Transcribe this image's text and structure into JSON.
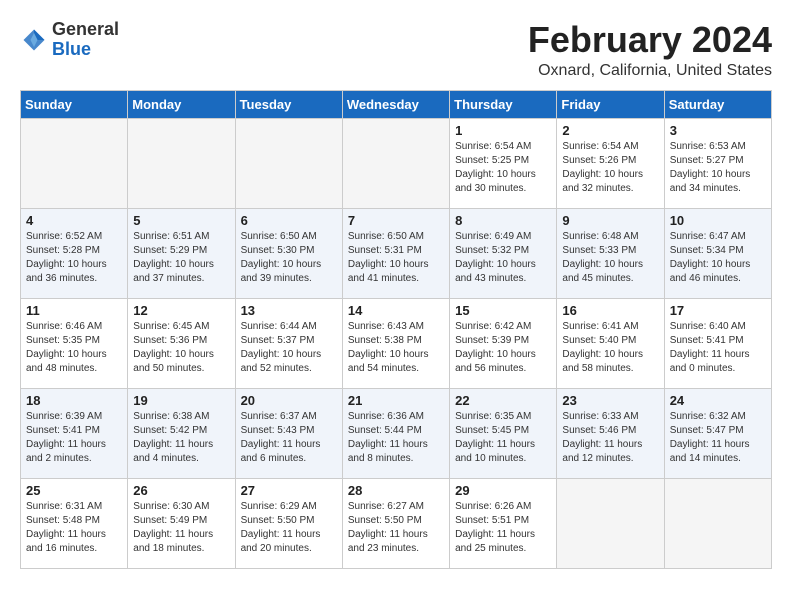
{
  "header": {
    "logo_general": "General",
    "logo_blue": "Blue",
    "month_title": "February 2024",
    "location": "Oxnard, California, United States"
  },
  "days_of_week": [
    "Sunday",
    "Monday",
    "Tuesday",
    "Wednesday",
    "Thursday",
    "Friday",
    "Saturday"
  ],
  "weeks": [
    {
      "alt": false,
      "days": [
        {
          "num": "",
          "info": ""
        },
        {
          "num": "",
          "info": ""
        },
        {
          "num": "",
          "info": ""
        },
        {
          "num": "",
          "info": ""
        },
        {
          "num": "1",
          "info": "Sunrise: 6:54 AM\nSunset: 5:25 PM\nDaylight: 10 hours\nand 30 minutes."
        },
        {
          "num": "2",
          "info": "Sunrise: 6:54 AM\nSunset: 5:26 PM\nDaylight: 10 hours\nand 32 minutes."
        },
        {
          "num": "3",
          "info": "Sunrise: 6:53 AM\nSunset: 5:27 PM\nDaylight: 10 hours\nand 34 minutes."
        }
      ]
    },
    {
      "alt": true,
      "days": [
        {
          "num": "4",
          "info": "Sunrise: 6:52 AM\nSunset: 5:28 PM\nDaylight: 10 hours\nand 36 minutes."
        },
        {
          "num": "5",
          "info": "Sunrise: 6:51 AM\nSunset: 5:29 PM\nDaylight: 10 hours\nand 37 minutes."
        },
        {
          "num": "6",
          "info": "Sunrise: 6:50 AM\nSunset: 5:30 PM\nDaylight: 10 hours\nand 39 minutes."
        },
        {
          "num": "7",
          "info": "Sunrise: 6:50 AM\nSunset: 5:31 PM\nDaylight: 10 hours\nand 41 minutes."
        },
        {
          "num": "8",
          "info": "Sunrise: 6:49 AM\nSunset: 5:32 PM\nDaylight: 10 hours\nand 43 minutes."
        },
        {
          "num": "9",
          "info": "Sunrise: 6:48 AM\nSunset: 5:33 PM\nDaylight: 10 hours\nand 45 minutes."
        },
        {
          "num": "10",
          "info": "Sunrise: 6:47 AM\nSunset: 5:34 PM\nDaylight: 10 hours\nand 46 minutes."
        }
      ]
    },
    {
      "alt": false,
      "days": [
        {
          "num": "11",
          "info": "Sunrise: 6:46 AM\nSunset: 5:35 PM\nDaylight: 10 hours\nand 48 minutes."
        },
        {
          "num": "12",
          "info": "Sunrise: 6:45 AM\nSunset: 5:36 PM\nDaylight: 10 hours\nand 50 minutes."
        },
        {
          "num": "13",
          "info": "Sunrise: 6:44 AM\nSunset: 5:37 PM\nDaylight: 10 hours\nand 52 minutes."
        },
        {
          "num": "14",
          "info": "Sunrise: 6:43 AM\nSunset: 5:38 PM\nDaylight: 10 hours\nand 54 minutes."
        },
        {
          "num": "15",
          "info": "Sunrise: 6:42 AM\nSunset: 5:39 PM\nDaylight: 10 hours\nand 56 minutes."
        },
        {
          "num": "16",
          "info": "Sunrise: 6:41 AM\nSunset: 5:40 PM\nDaylight: 10 hours\nand 58 minutes."
        },
        {
          "num": "17",
          "info": "Sunrise: 6:40 AM\nSunset: 5:41 PM\nDaylight: 11 hours\nand 0 minutes."
        }
      ]
    },
    {
      "alt": true,
      "days": [
        {
          "num": "18",
          "info": "Sunrise: 6:39 AM\nSunset: 5:41 PM\nDaylight: 11 hours\nand 2 minutes."
        },
        {
          "num": "19",
          "info": "Sunrise: 6:38 AM\nSunset: 5:42 PM\nDaylight: 11 hours\nand 4 minutes."
        },
        {
          "num": "20",
          "info": "Sunrise: 6:37 AM\nSunset: 5:43 PM\nDaylight: 11 hours\nand 6 minutes."
        },
        {
          "num": "21",
          "info": "Sunrise: 6:36 AM\nSunset: 5:44 PM\nDaylight: 11 hours\nand 8 minutes."
        },
        {
          "num": "22",
          "info": "Sunrise: 6:35 AM\nSunset: 5:45 PM\nDaylight: 11 hours\nand 10 minutes."
        },
        {
          "num": "23",
          "info": "Sunrise: 6:33 AM\nSunset: 5:46 PM\nDaylight: 11 hours\nand 12 minutes."
        },
        {
          "num": "24",
          "info": "Sunrise: 6:32 AM\nSunset: 5:47 PM\nDaylight: 11 hours\nand 14 minutes."
        }
      ]
    },
    {
      "alt": false,
      "days": [
        {
          "num": "25",
          "info": "Sunrise: 6:31 AM\nSunset: 5:48 PM\nDaylight: 11 hours\nand 16 minutes."
        },
        {
          "num": "26",
          "info": "Sunrise: 6:30 AM\nSunset: 5:49 PM\nDaylight: 11 hours\nand 18 minutes."
        },
        {
          "num": "27",
          "info": "Sunrise: 6:29 AM\nSunset: 5:50 PM\nDaylight: 11 hours\nand 20 minutes."
        },
        {
          "num": "28",
          "info": "Sunrise: 6:27 AM\nSunset: 5:50 PM\nDaylight: 11 hours\nand 23 minutes."
        },
        {
          "num": "29",
          "info": "Sunrise: 6:26 AM\nSunset: 5:51 PM\nDaylight: 11 hours\nand 25 minutes."
        },
        {
          "num": "",
          "info": ""
        },
        {
          "num": "",
          "info": ""
        }
      ]
    }
  ]
}
